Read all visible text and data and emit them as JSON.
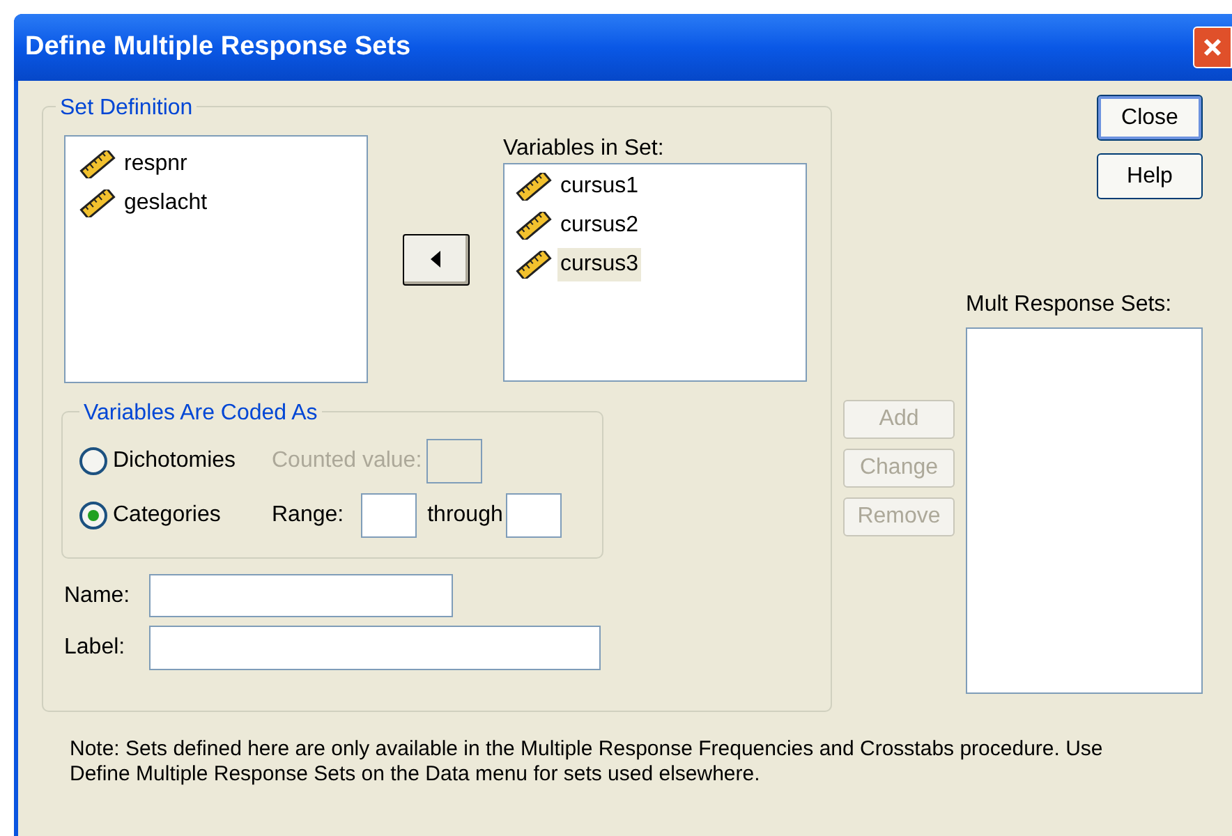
{
  "window": {
    "title": "Define Multiple Response Sets"
  },
  "set_definition": {
    "title": "Set Definition",
    "source_variables": [
      {
        "name": "respnr",
        "selected": false
      },
      {
        "name": "geslacht",
        "selected": false
      }
    ],
    "variables_in_set_label": "Variables in Set:",
    "variables_in_set": [
      {
        "name": "cursus1",
        "selected": false
      },
      {
        "name": "cursus2",
        "selected": false
      },
      {
        "name": "cursus3",
        "selected": true
      }
    ],
    "coded_as": {
      "title": "Variables Are Coded As",
      "options": [
        {
          "label": "Dichotomies",
          "selected": false
        },
        {
          "label": "Categories",
          "selected": true
        }
      ],
      "counted_value_label": "Counted value:",
      "range_label": "Range:",
      "through_label": "through"
    },
    "name_label": "Name:",
    "label_label": "Label:"
  },
  "set_buttons": [
    {
      "label": "Add",
      "disabled": true
    },
    {
      "label": "Change",
      "disabled": true
    },
    {
      "label": "Remove",
      "disabled": true
    }
  ],
  "dialog_buttons": [
    {
      "label": "Close",
      "default": true
    },
    {
      "label": "Help",
      "default": false
    }
  ],
  "mult_response_sets_label": "Mult Response Sets:",
  "note": "Note: Sets defined here are only available in the Multiple Response Frequencies and Crosstabs procedure.  Use  Define Multiple Response Sets on the Data menu for sets used elsewhere."
}
